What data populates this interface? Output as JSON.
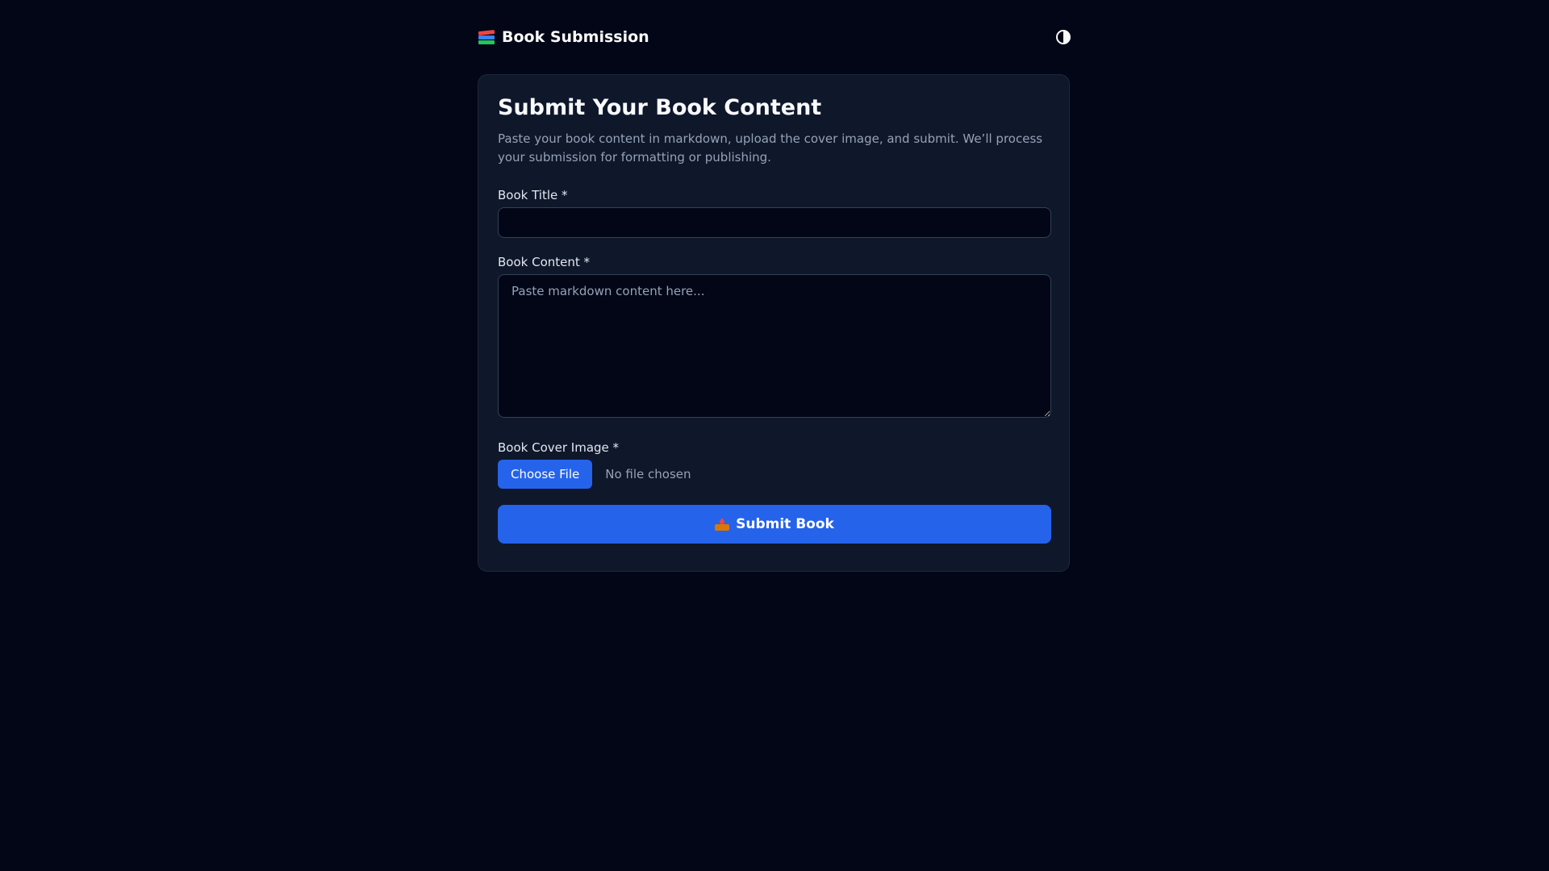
{
  "header": {
    "title": "Book Submission",
    "logo_icon": "books-icon",
    "theme_toggle_icon": "half-circle-contrast-icon"
  },
  "form": {
    "heading": "Submit Your Book Content",
    "description": "Paste your book content in markdown, upload the cover image, and submit. We’ll process your submission for formatting or publishing.",
    "title_field": {
      "label": "Book Title *",
      "value": "",
      "placeholder": ""
    },
    "content_field": {
      "label": "Book Content *",
      "value": "",
      "placeholder": "Paste markdown content here..."
    },
    "cover_field": {
      "label": "Book Cover Image *",
      "button_label": "Choose File",
      "status": "No file chosen"
    },
    "submit": {
      "label": "Submit Book",
      "icon": "outbox-tray-icon"
    }
  },
  "colors": {
    "background": "#030616",
    "card": "#0f172a",
    "accent": "#2563eb",
    "muted_text": "#94a3b8"
  }
}
